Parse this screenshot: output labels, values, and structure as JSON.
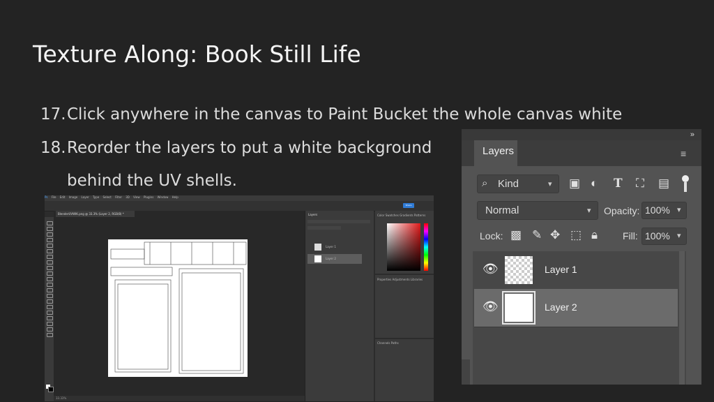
{
  "slide": {
    "title": "Texture Along: Book Still Life",
    "steps": [
      {
        "num": "17.",
        "text": "Click anywhere in the canvas to Paint Bucket the whole canvas white"
      },
      {
        "num": "18.",
        "text": "Reorder the layers to put a white background"
      }
    ],
    "step18_cont": "behind the UV shells."
  },
  "ps_small": {
    "menu": [
      "Ps",
      "File",
      "Edit",
      "Image",
      "Layer",
      "Type",
      "Select",
      "Filter",
      "3D",
      "View",
      "Plugins",
      "Window",
      "Help"
    ],
    "share": "Share",
    "doc_tab": "BlenderUVWIK.png @ 33.3% (Layer 2, RGB/8) *",
    "status": "33.33%",
    "layers_title": "Layers",
    "layers": [
      "Layer 1",
      "Layer 2"
    ],
    "color_tabs": [
      "Color",
      "Swatches",
      "Gradients",
      "Patterns"
    ],
    "props_tabs": [
      "Properties",
      "Adjustments",
      "Libraries"
    ],
    "bottom_tabs": [
      "Channels",
      "Paths"
    ],
    "colors": {
      "accent_blue": "#2f7bd6",
      "panel_gray": "#3b3b3b",
      "canvas_white": "#ffffff"
    }
  },
  "layers_panel": {
    "tab": "Layers",
    "filter_label": "Kind",
    "blend_mode": "Normal",
    "opacity_label": "Opacity:",
    "opacity_value": "100%",
    "lock_label": "Lock:",
    "fill_label": "Fill:",
    "fill_value": "100%",
    "layers": [
      {
        "name": "Layer 1",
        "thumbnail": "transparent-checker",
        "visible": true,
        "selected": false
      },
      {
        "name": "Layer 2",
        "thumbnail": "white",
        "visible": true,
        "selected": true
      }
    ],
    "icons": {
      "collapse": "double-chevron-right-icon",
      "menu": "hamburger-menu-icon",
      "search": "search-icon",
      "filter_pixel": "image-icon",
      "filter_adjust": "half-circle-icon",
      "filter_type": "type-t-icon",
      "filter_shape": "transform-icon",
      "filter_smart": "smart-object-icon",
      "lock_pixels": "checkerboard-icon",
      "lock_brush": "brush-icon",
      "lock_move": "move-arrows-icon",
      "lock_artboard": "artboard-icon",
      "lock_all": "padlock-icon",
      "visibility": "eye-icon"
    }
  }
}
